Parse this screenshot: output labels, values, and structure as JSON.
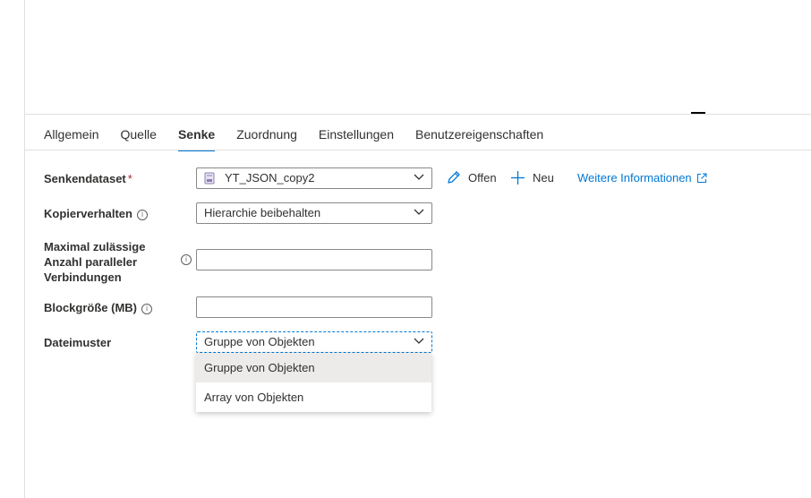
{
  "tabs": [
    {
      "label": "Allgemein",
      "active": false
    },
    {
      "label": "Quelle",
      "active": false
    },
    {
      "label": "Senke",
      "active": true
    },
    {
      "label": "Zuordnung",
      "active": false
    },
    {
      "label": "Einstellungen",
      "active": false
    },
    {
      "label": "Benutzereigenschaften",
      "active": false
    }
  ],
  "form": {
    "sink_dataset": {
      "label": "Senkendataset",
      "required_mark": "*",
      "value": "YT_JSON_copy2",
      "icon": "json-dataset-icon"
    },
    "copy_behavior": {
      "label": "Kopierverhalten",
      "value": "Hierarchie beibehalten",
      "info_icon": "info-icon"
    },
    "max_connections": {
      "label_lines": [
        "Maximal zulässige",
        "Anzahl paralleler",
        "Verbindungen"
      ],
      "value": "",
      "info_icon": "info-icon"
    },
    "block_size": {
      "label": "Blockgröße (MB)",
      "value": "",
      "info_icon": "info-icon"
    },
    "file_pattern": {
      "label": "Dateimuster",
      "value": "Gruppe von Objekten"
    }
  },
  "actions": {
    "open_label": "Offen",
    "new_label": "Neu",
    "more_info_label": "Weitere Informationen"
  },
  "dropdown": {
    "options": [
      {
        "label": "Gruppe von Objekten",
        "selected": true
      },
      {
        "label": "Array von Objekten",
        "selected": false
      }
    ]
  },
  "colors": {
    "accent": "#0078d4",
    "required": "#a4262c",
    "text": "#323130"
  }
}
